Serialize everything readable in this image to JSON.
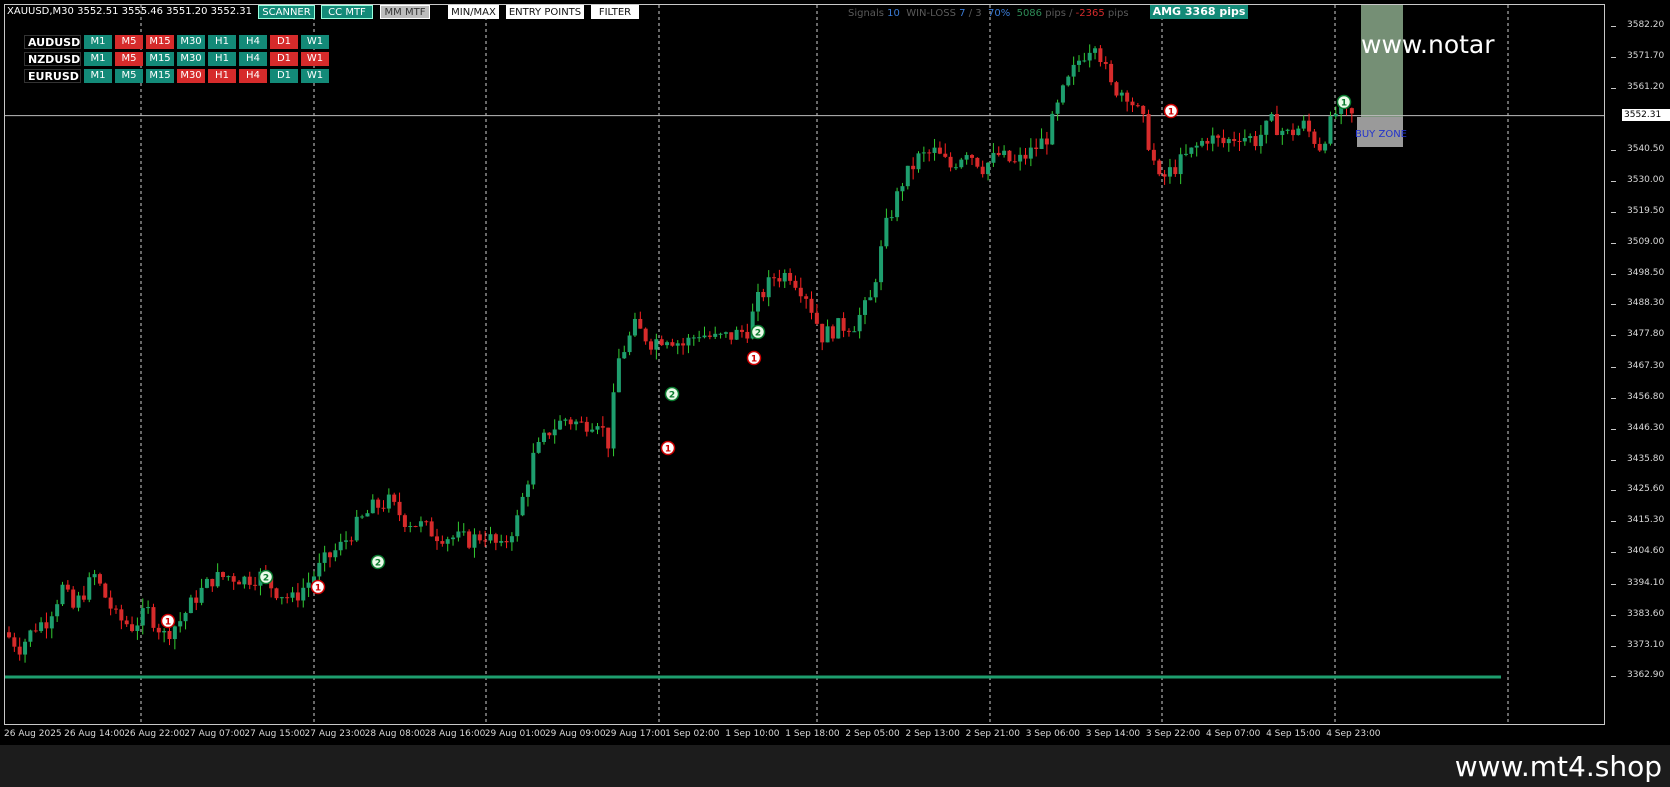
{
  "symbol_header": "XAUUSD,M30  3552.51 3555.46 3551.20 3552.31",
  "toolbar": {
    "scanner": "SCANNER",
    "cc_mtf": "CC MTF",
    "mm_mtf": "MM MTF",
    "min_max": "MIN/MAX",
    "entry_points": "ENTRY POINTS",
    "filter": "FILTER"
  },
  "stats": {
    "signals_label": "Signals",
    "signals_value": "10",
    "winloss_label": "WIN-LOSS",
    "wins": "7",
    "sep": "/",
    "losses": "3",
    "winrate": "70%",
    "pos_pips": "5086",
    "pos_unit": "pips /",
    "neg_pips": "-2365",
    "neg_unit": "pips"
  },
  "amg": "AMG   3368 pips",
  "mtf_panel": {
    "rows": [
      {
        "symbol": "AUDUSD",
        "cells": [
          [
            "M1",
            "g"
          ],
          [
            "M5",
            "r"
          ],
          [
            "M15",
            "r"
          ],
          [
            "M30",
            "g"
          ],
          [
            "H1",
            "g"
          ],
          [
            "H4",
            "g"
          ],
          [
            "D1",
            "r"
          ],
          [
            "W1",
            "g"
          ]
        ]
      },
      {
        "symbol": "NZDUSD",
        "cells": [
          [
            "M1",
            "g"
          ],
          [
            "M5",
            "r"
          ],
          [
            "M15",
            "g"
          ],
          [
            "M30",
            "g"
          ],
          [
            "H1",
            "g"
          ],
          [
            "H4",
            "g"
          ],
          [
            "D1",
            "r"
          ],
          [
            "W1",
            "r"
          ]
        ]
      },
      {
        "symbol": "EURUSD",
        "cells": [
          [
            "M1",
            "g"
          ],
          [
            "M5",
            "g"
          ],
          [
            "M15",
            "g"
          ],
          [
            "M30",
            "r"
          ],
          [
            "H1",
            "r"
          ],
          [
            "H4",
            "r"
          ],
          [
            "D1",
            "g"
          ],
          [
            "W1",
            "g"
          ]
        ]
      }
    ]
  },
  "watermark_top": "www.notar",
  "watermark_bottom": "www.mt4.shop",
  "buy_zone": "BUY ZONE",
  "current_price": "3552.31",
  "colors": {
    "bull": "#1e9e6e",
    "bear": "#d62b2b",
    "wick_up": "#32cd32",
    "wick_down": "#ff2020",
    "background": "#000000"
  },
  "price_axis": [
    "3582.20",
    "3571.70",
    "3561.20",
    "3540.50",
    "3530.00",
    "3519.50",
    "3509.00",
    "3498.50",
    "3488.30",
    "3477.80",
    "3467.30",
    "3456.80",
    "3446.30",
    "3435.80",
    "3425.60",
    "3415.30",
    "3404.60",
    "3394.10",
    "3383.60",
    "3373.10",
    "3362.90"
  ],
  "time_axis": [
    "26 Aug 2025",
    "26 Aug 14:00",
    "26 Aug 22:00",
    "27 Aug 07:00",
    "27 Aug 15:00",
    "27 Aug 23:00",
    "28 Aug 08:00",
    "28 Aug 16:00",
    "29 Aug 01:00",
    "29 Aug 09:00",
    "29 Aug 17:00",
    "1 Sep 02:00",
    "1 Sep 10:00",
    "1 Sep 18:00",
    "2 Sep 05:00",
    "2 Sep 13:00",
    "2 Sep 21:00",
    "3 Sep 06:00",
    "3 Sep 14:00",
    "3 Sep 22:00",
    "4 Sep 07:00",
    "4 Sep 15:00",
    "4 Sep 23:00"
  ],
  "signals": [
    {
      "label": "1",
      "type": "sell"
    },
    {
      "label": "2",
      "type": "buy"
    },
    {
      "label": "1",
      "type": "sell"
    },
    {
      "label": "2",
      "type": "buy"
    },
    {
      "label": "1",
      "type": "sell"
    },
    {
      "label": "2",
      "type": "buy"
    },
    {
      "label": "1",
      "type": "sell"
    },
    {
      "label": "2",
      "type": "buy"
    },
    {
      "label": "1",
      "type": "sell"
    },
    {
      "label": "1",
      "type": "buy"
    }
  ],
  "chart_data": {
    "type": "candlestick",
    "symbol": "XAUUSD",
    "timeframe": "M30",
    "ylim": [
      3362.9,
      3582.2
    ],
    "last": {
      "open": 3552.51,
      "high": 3555.46,
      "low": 3551.2,
      "close": 3552.31
    },
    "path": [
      [
        0,
        3378
      ],
      [
        3,
        3373
      ],
      [
        6,
        3380
      ],
      [
        8,
        3382
      ],
      [
        11,
        3393
      ],
      [
        13,
        3386
      ],
      [
        17,
        3397
      ],
      [
        19,
        3390
      ],
      [
        21,
        3383
      ],
      [
        24,
        3380
      ],
      [
        27,
        3385
      ],
      [
        30,
        3377
      ],
      [
        33,
        3382
      ],
      [
        36,
        3390
      ],
      [
        39,
        3396
      ],
      [
        42,
        3397
      ],
      [
        45,
        3396
      ],
      [
        48,
        3397
      ],
      [
        51,
        3392
      ],
      [
        54,
        3389
      ],
      [
        57,
        3395
      ],
      [
        60,
        3402
      ],
      [
        63,
        3407
      ],
      [
        66,
        3414
      ],
      [
        69,
        3420
      ],
      [
        72,
        3422
      ],
      [
        75,
        3416
      ],
      [
        78,
        3414
      ],
      [
        81,
        3411
      ],
      [
        84,
        3410
      ],
      [
        87,
        3409
      ],
      [
        90,
        3411
      ],
      [
        93,
        3406
      ],
      [
        96,
        3416
      ],
      [
        99,
        3437
      ],
      [
        102,
        3446
      ],
      [
        105,
        3450
      ],
      [
        108,
        3448
      ],
      [
        111,
        3450
      ],
      [
        113,
        3442
      ],
      [
        115,
        3470
      ],
      [
        118,
        3481
      ],
      [
        121,
        3476
      ],
      [
        124,
        3478
      ],
      [
        127,
        3475
      ],
      [
        130,
        3479
      ],
      [
        133,
        3477
      ],
      [
        136,
        3478
      ],
      [
        139,
        3480
      ],
      [
        141,
        3490
      ],
      [
        144,
        3498
      ],
      [
        147,
        3499
      ],
      [
        150,
        3492
      ],
      [
        153,
        3478
      ],
      [
        156,
        3481
      ],
      [
        159,
        3482
      ],
      [
        162,
        3490
      ],
      [
        165,
        3515
      ],
      [
        168,
        3530
      ],
      [
        171,
        3538
      ],
      [
        174,
        3540
      ],
      [
        177,
        3535
      ],
      [
        180,
        3541
      ],
      [
        183,
        3535
      ],
      [
        186,
        3539
      ],
      [
        189,
        3536
      ],
      [
        192,
        3540
      ],
      [
        195,
        3545
      ],
      [
        198,
        3560
      ],
      [
        201,
        3571
      ],
      [
        204,
        3578
      ],
      [
        207,
        3562
      ],
      [
        210,
        3560
      ],
      [
        213,
        3550
      ],
      [
        216,
        3530
      ],
      [
        219,
        3535
      ],
      [
        222,
        3540
      ],
      [
        225,
        3545
      ],
      [
        228,
        3543
      ],
      [
        231,
        3546
      ],
      [
        234,
        3544
      ],
      [
        237,
        3550
      ],
      [
        240,
        3546
      ],
      [
        243,
        3549
      ],
      [
        246,
        3542
      ],
      [
        249,
        3553
      ],
      [
        252,
        3552
      ]
    ]
  }
}
